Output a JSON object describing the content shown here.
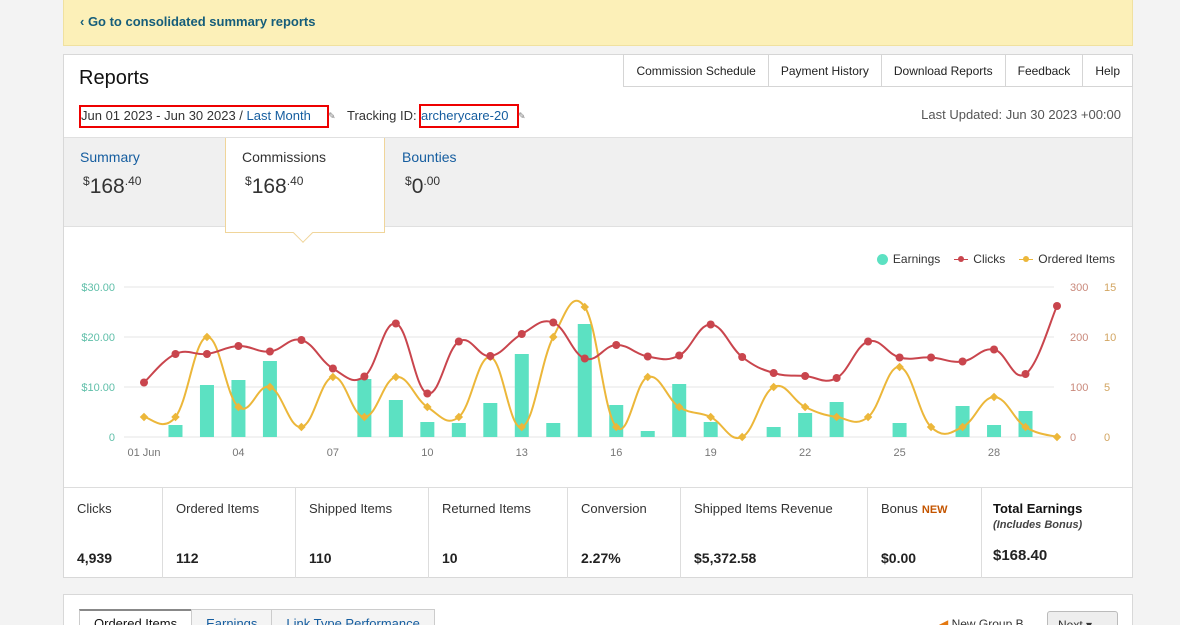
{
  "banner": {
    "link": "‹ Go to consolidated summary reports"
  },
  "reports": {
    "title": "Reports",
    "top_buttons": [
      "Commission Schedule",
      "Payment History",
      "Download Reports",
      "Feedback",
      "Help"
    ],
    "date_range": "Jun 01 2023 - Jun 30 2023 / ",
    "date_range_link": "Last Month",
    "tracking_label": "Tracking ID:",
    "tracking_id": "archerycare-20",
    "last_updated": "Last Updated: Jun 30 2023 +00:00",
    "edit_icon": "pencil-icon"
  },
  "summary_tabs": [
    {
      "label": "Summary",
      "currency": "$",
      "whole": "168",
      "fraction": ".40"
    },
    {
      "label": "Commissions",
      "currency": "$",
      "whole": "168",
      "fraction": ".40"
    },
    {
      "label": "Bounties",
      "currency": "$",
      "whole": "0",
      "fraction": ".00"
    }
  ],
  "chart_data": {
    "type": "bar",
    "x": [
      "01 Jun",
      "02",
      "03",
      "04",
      "05",
      "06",
      "07",
      "08",
      "09",
      "10",
      "11",
      "12",
      "13",
      "14",
      "15",
      "16",
      "17",
      "18",
      "19",
      "20",
      "21",
      "22",
      "23",
      "24",
      "25",
      "26",
      "27",
      "28",
      "29",
      "30"
    ],
    "x_tick_labels": [
      "01 Jun",
      "04",
      "07",
      "10",
      "13",
      "16",
      "19",
      "22",
      "25",
      "28"
    ],
    "legend": [
      "Earnings",
      "Clicks",
      "Ordered Items"
    ],
    "colors": {
      "earnings": "#5ce1c2",
      "clicks": "#c9454d",
      "ordered_items": "#ecb73a"
    },
    "series": [
      {
        "name": "Earnings",
        "type": "bar",
        "axis": "left",
        "values": [
          0,
          2.4,
          10.4,
          11.4,
          15.2,
          0,
          0,
          11.6,
          7.4,
          3.0,
          2.8,
          6.8,
          16.6,
          2.8,
          22.6,
          6.4,
          1.2,
          10.6,
          3.0,
          0,
          2.0,
          4.8,
          7.0,
          0,
          2.8,
          0,
          6.2,
          2.4,
          5.2,
          0
        ]
      },
      {
        "name": "Clicks",
        "type": "line",
        "axis": "right1",
        "values": [
          109,
          166,
          166,
          182,
          171,
          194,
          137,
          121,
          227,
          87,
          191,
          162,
          206,
          229,
          157,
          184,
          161,
          163,
          225,
          160,
          128,
          122,
          118,
          191,
          159,
          159,
          151,
          175,
          126,
          262
        ]
      },
      {
        "name": "Ordered Items",
        "type": "line",
        "axis": "right2",
        "values": [
          2,
          2,
          10,
          3,
          5,
          1,
          6,
          2,
          6,
          3,
          2,
          8,
          1,
          10,
          13,
          1,
          6,
          3,
          2,
          0,
          5,
          3,
          2,
          2,
          7,
          1,
          1,
          4,
          1,
          0
        ]
      }
    ],
    "axes": {
      "left": {
        "ticks": [
          "0",
          "$10.00",
          "$20.00",
          "$30.00"
        ],
        "ylim": [
          0,
          30
        ]
      },
      "right1": {
        "ticks": [
          "0",
          "100",
          "200",
          "300"
        ],
        "ylim": [
          0,
          300
        ]
      },
      "right2": {
        "ticks": [
          "0",
          "5",
          "10",
          "15"
        ],
        "ylim": [
          0,
          15
        ]
      }
    },
    "grid": true,
    "legend_position": "top-right"
  },
  "stats": [
    {
      "label": "Clicks",
      "value": "4,939"
    },
    {
      "label": "Ordered Items",
      "value": "112"
    },
    {
      "label": "Shipped Items",
      "value": "110"
    },
    {
      "label": "Returned Items",
      "value": "10"
    },
    {
      "label": "Conversion",
      "value": "2.27%"
    },
    {
      "label": "Shipped Items Revenue",
      "value": "$5,372.58"
    },
    {
      "label": "Bonus",
      "badge": "NEW",
      "value": "$0.00"
    },
    {
      "label": "Total Earnings",
      "sub": "(Includes Bonus)",
      "value": "$168.40"
    }
  ],
  "bottom": {
    "tabs": [
      "Ordered Items",
      "Earnings",
      "Link Type Performance"
    ],
    "new_group": "New Group B",
    "next_btn": "Next ▾"
  }
}
